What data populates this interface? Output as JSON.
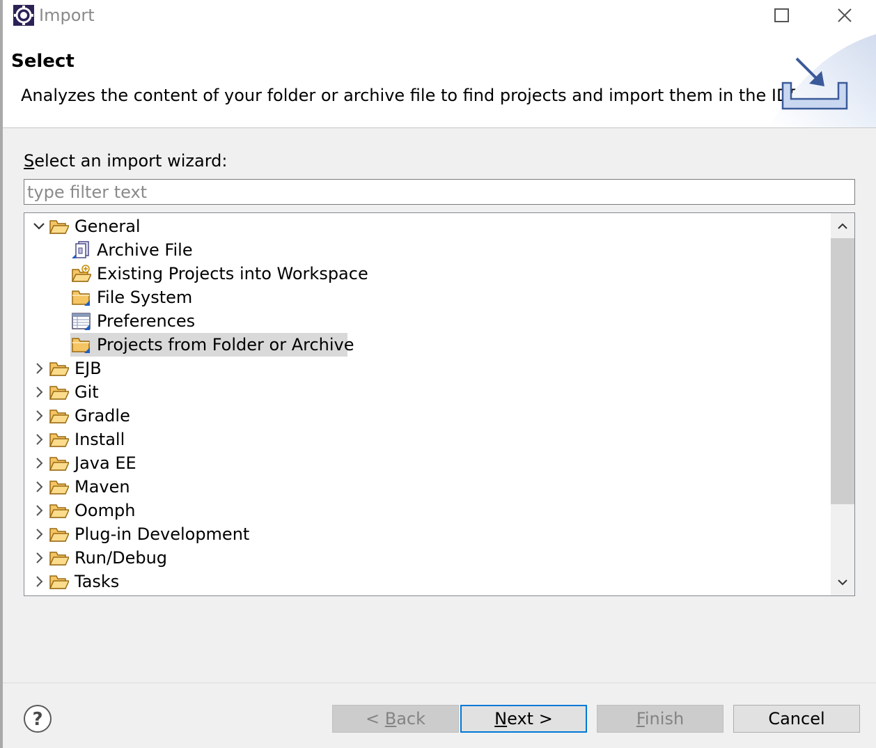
{
  "window": {
    "title": "Import",
    "controls": [
      "minimize-icon",
      "maximize-icon",
      "close-icon"
    ]
  },
  "banner": {
    "title": "Select",
    "description": "Analyzes the content of your folder or archive file to find projects and import them in the IDE.",
    "icon": "import-wizard-icon"
  },
  "wizard": {
    "label_prefix": "S",
    "label_rest": "elect an import wizard:",
    "filter_value": "",
    "filter_placeholder": "type filter text"
  },
  "tree": {
    "items": [
      {
        "label": "General",
        "expanded": true,
        "icon": "folder-open-icon"
      },
      {
        "label": "Archive File",
        "icon": "archive-file-icon",
        "child": true
      },
      {
        "label": "Existing Projects into Workspace",
        "icon": "existing-projects-icon",
        "child": true
      },
      {
        "label": "File System",
        "icon": "folder-icon",
        "child": true
      },
      {
        "label": "Preferences",
        "icon": "preferences-icon",
        "child": true
      },
      {
        "label": "Projects from Folder or Archive",
        "icon": "folder-icon",
        "child": true,
        "selected": true
      },
      {
        "label": "EJB",
        "expanded": false,
        "icon": "folder-open-icon"
      },
      {
        "label": "Git",
        "expanded": false,
        "icon": "folder-open-icon"
      },
      {
        "label": "Gradle",
        "expanded": false,
        "icon": "folder-open-icon"
      },
      {
        "label": "Install",
        "expanded": false,
        "icon": "folder-open-icon"
      },
      {
        "label": "Java EE",
        "expanded": false,
        "icon": "folder-open-icon"
      },
      {
        "label": "Maven",
        "expanded": false,
        "icon": "folder-open-icon"
      },
      {
        "label": "Oomph",
        "expanded": false,
        "icon": "folder-open-icon"
      },
      {
        "label": "Plug-in Development",
        "expanded": false,
        "icon": "folder-open-icon"
      },
      {
        "label": "Run/Debug",
        "expanded": false,
        "icon": "folder-open-icon"
      },
      {
        "label": "Tasks",
        "expanded": false,
        "icon": "folder-open-icon"
      }
    ]
  },
  "buttons": {
    "back": {
      "prefix": "< ",
      "mnemonic": "B",
      "rest": "ack",
      "enabled": false
    },
    "next": {
      "mnemonic": "N",
      "rest": "ext >",
      "enabled": true
    },
    "finish": {
      "mnemonic": "F",
      "rest": "inish",
      "enabled": false
    },
    "cancel": {
      "label": "Cancel",
      "enabled": true
    }
  },
  "colors": {
    "accent": "#0078d7",
    "folder": "#f5c463",
    "selection": "#d9d9d9"
  }
}
